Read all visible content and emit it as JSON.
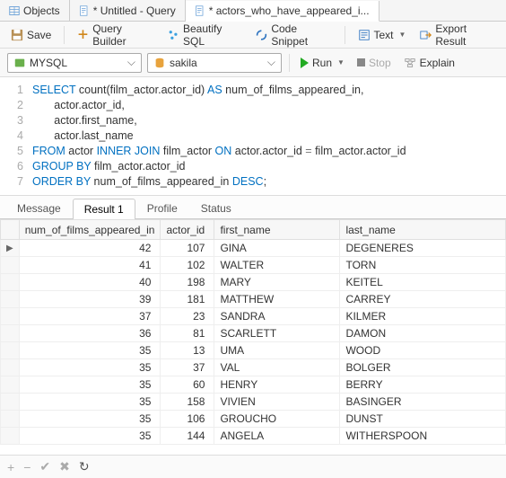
{
  "topTabs": {
    "objects": "Objects",
    "untitled": "* Untitled - Query",
    "current": "* actors_who_have_appeared_i..."
  },
  "toolbar": {
    "save": "Save",
    "queryBuilder": "Query Builder",
    "beautify": "Beautify SQL",
    "codeSnippet": "Code Snippet",
    "text": "Text",
    "export": "Export Result"
  },
  "combo": {
    "conn": "MYSQL",
    "db": "sakila",
    "run": "Run",
    "stop": "Stop",
    "explain": "Explain"
  },
  "code": {
    "l1a": "SELECT",
    "l1b": " count(film_actor.actor_id) ",
    "l1c": "AS",
    "l1d": " num_of_films_appeared_in,",
    "l2": "       actor.actor_id,",
    "l3": "       actor.first_name,",
    "l4": "       actor.last_name",
    "l5a": "FROM",
    "l5b": " actor ",
    "l5c": "INNER JOIN",
    "l5d": " film_actor ",
    "l5e": "ON",
    "l5f": " actor.actor_id ",
    "l5g": "=",
    "l5h": " film_actor.actor_id",
    "l6a": "GROUP BY",
    "l6b": " film_actor.actor_id",
    "l7a": "ORDER BY",
    "l7b": " num_of_films_appeared_in ",
    "l7c": "DESC",
    "l7d": ";"
  },
  "resultTabs": {
    "message": "Message",
    "result1": "Result 1",
    "profile": "Profile",
    "status": "Status"
  },
  "grid": {
    "h1": "num_of_films_appeared_in",
    "h2": "actor_id",
    "h3": "first_name",
    "h4": "last_name",
    "rows": [
      {
        "a": "42",
        "b": "107",
        "c": "GINA",
        "d": "DEGENERES"
      },
      {
        "a": "41",
        "b": "102",
        "c": "WALTER",
        "d": "TORN"
      },
      {
        "a": "40",
        "b": "198",
        "c": "MARY",
        "d": "KEITEL"
      },
      {
        "a": "39",
        "b": "181",
        "c": "MATTHEW",
        "d": "CARREY"
      },
      {
        "a": "37",
        "b": "23",
        "c": "SANDRA",
        "d": "KILMER"
      },
      {
        "a": "36",
        "b": "81",
        "c": "SCARLETT",
        "d": "DAMON"
      },
      {
        "a": "35",
        "b": "13",
        "c": "UMA",
        "d": "WOOD"
      },
      {
        "a": "35",
        "b": "37",
        "c": "VAL",
        "d": "BOLGER"
      },
      {
        "a": "35",
        "b": "60",
        "c": "HENRY",
        "d": "BERRY"
      },
      {
        "a": "35",
        "b": "158",
        "c": "VIVIEN",
        "d": "BASINGER"
      },
      {
        "a": "35",
        "b": "106",
        "c": "GROUCHO",
        "d": "DUNST"
      },
      {
        "a": "35",
        "b": "144",
        "c": "ANGELA",
        "d": "WITHERSPOON"
      }
    ]
  }
}
